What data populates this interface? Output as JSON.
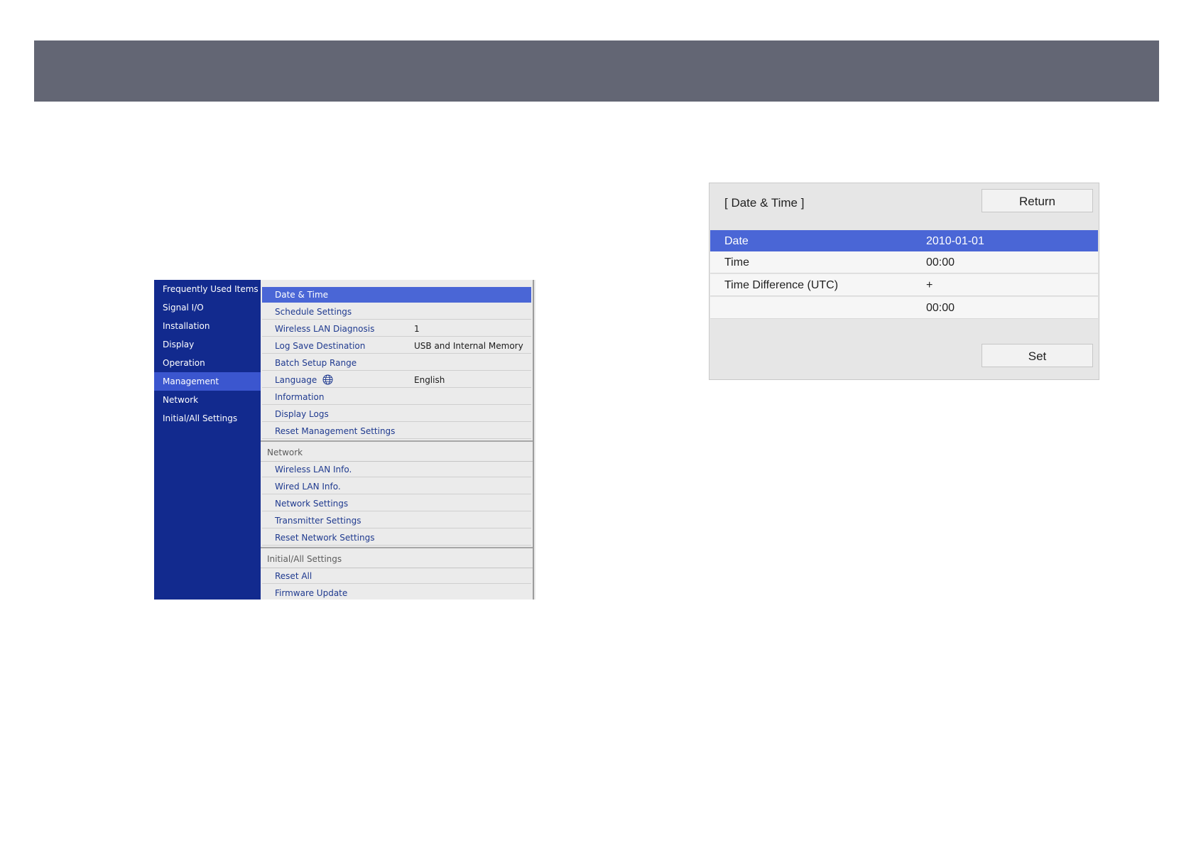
{
  "menu": {
    "sidebar": [
      {
        "label": "Frequently Used Items",
        "active": false
      },
      {
        "label": "Signal I/O",
        "active": false
      },
      {
        "label": "Installation",
        "active": false
      },
      {
        "label": "Display",
        "active": false
      },
      {
        "label": "Operation",
        "active": false
      },
      {
        "label": "Management",
        "active": true
      },
      {
        "label": "Network",
        "active": false
      },
      {
        "label": "Initial/All Settings",
        "active": false
      }
    ],
    "management_items": [
      {
        "label": "Date & Time",
        "value": ""
      },
      {
        "label": "Schedule Settings",
        "value": ""
      },
      {
        "label": "Wireless LAN Diagnosis",
        "value": "1"
      },
      {
        "label": "Log Save Destination",
        "value": "USB and Internal Memory"
      },
      {
        "label": "Batch Setup Range",
        "value": ""
      },
      {
        "label": "Language",
        "value": "English",
        "icon": "globe-icon"
      },
      {
        "label": "Information",
        "value": ""
      },
      {
        "label": "Display Logs",
        "value": ""
      },
      {
        "label": "Reset Management Settings",
        "value": ""
      }
    ],
    "network_section": {
      "title": "Network",
      "items": [
        {
          "label": "Wireless LAN Info."
        },
        {
          "label": "Wired LAN Info."
        },
        {
          "label": "Network Settings"
        },
        {
          "label": "Transmitter Settings"
        },
        {
          "label": "Reset Network Settings"
        }
      ]
    },
    "initial_section": {
      "title": "Initial/All Settings",
      "items": [
        {
          "label": "Reset All"
        },
        {
          "label": "Firmware Update"
        }
      ]
    }
  },
  "dialog": {
    "title": "[ Date & Time ]",
    "return_label": "Return",
    "set_label": "Set",
    "rows": [
      {
        "label": "Date",
        "value": "2010-01-01"
      },
      {
        "label": "Time",
        "value": "00:00"
      },
      {
        "label": "Time Difference (UTC)",
        "value": "+"
      },
      {
        "label": "",
        "value": "00:00"
      }
    ]
  },
  "colors": {
    "banner": "#636674",
    "sidebar": "#122a8e",
    "highlight": "#4a66d6",
    "menu_text": "#1f3a8f"
  }
}
